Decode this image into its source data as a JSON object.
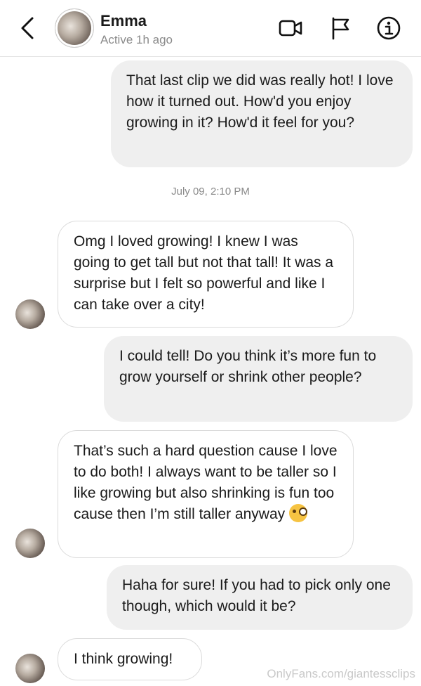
{
  "header": {
    "name": "Emma",
    "status": "Active 1h ago",
    "icons": [
      "back-icon",
      "video-call-icon",
      "flag-icon",
      "info-icon"
    ]
  },
  "messages": [
    {
      "from": "me",
      "text": "That last clip we did was really hot! I love how it turned out. How'd you enjoy growing in it? How'd it feel for you?"
    },
    {
      "from": "them",
      "text": "Omg I loved growing! I knew I was going to get tall but not that tall! It was a surprise but I felt so powerful and like I can take over a city!"
    },
    {
      "from": "me",
      "text": "I could tell! Do you think it’s more fun to grow yourself or shrink other people?"
    },
    {
      "from": "them",
      "text": "That’s such a hard question cause I love to do both! I always want to be taller so I like growing but also shrinking is fun too cause then I’m still taller anyway"
    },
    {
      "from": "me",
      "text": "Haha for sure! If you had to pick only one though, which would it be?"
    },
    {
      "from": "them",
      "text": "I think growing!"
    }
  ],
  "timestamp": "July 09, 2:10 PM",
  "emoji": "winking-face-with-tongue",
  "watermark": "OnlyFans.com/giantessclips"
}
